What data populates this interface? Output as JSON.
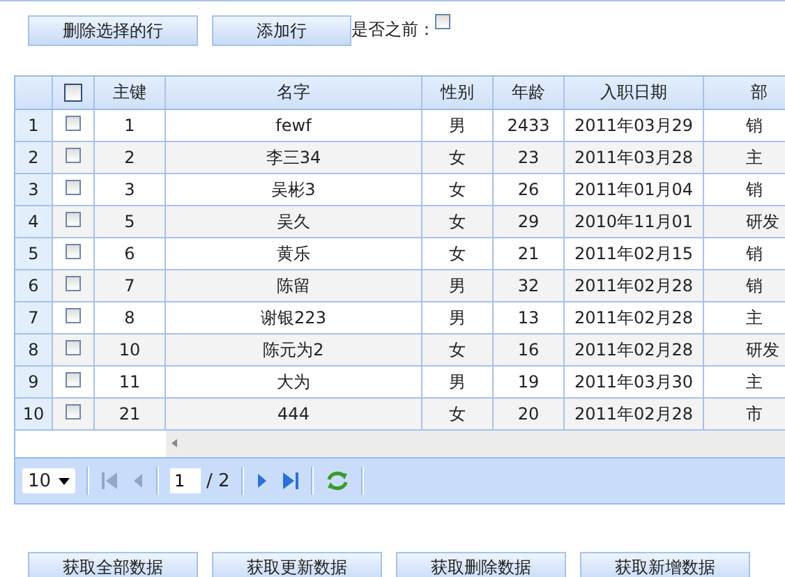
{
  "toolbar": {
    "buttons": [
      "删除选择的行",
      "添加行"
    ],
    "insert_before": {
      "label": "是否之前：",
      "checked": false
    }
  },
  "grid": {
    "columns": [
      "主键",
      "名字",
      "性别",
      "年龄",
      "入职日期",
      "部"
    ],
    "header_checked": false,
    "rows": [
      {
        "num": "1",
        "checked": false,
        "cells": [
          "1",
          "fewf",
          "男",
          "2433",
          "2011年03月29",
          "销"
        ]
      },
      {
        "num": "2",
        "checked": false,
        "cells": [
          "2",
          "李三34",
          "女",
          "23",
          "2011年03月28",
          "主"
        ]
      },
      {
        "num": "3",
        "checked": false,
        "cells": [
          "3",
          "吴彬3",
          "女",
          "26",
          "2011年01月04",
          "销"
        ]
      },
      {
        "num": "4",
        "checked": false,
        "cells": [
          "5",
          "吴久",
          "女",
          "29",
          "2010年11月01",
          "研发"
        ]
      },
      {
        "num": "5",
        "checked": false,
        "cells": [
          "6",
          "黄乐",
          "女",
          "21",
          "2011年02月15",
          "销"
        ]
      },
      {
        "num": "6",
        "checked": false,
        "cells": [
          "7",
          "陈留",
          "男",
          "32",
          "2011年02月28",
          "销"
        ]
      },
      {
        "num": "7",
        "checked": false,
        "cells": [
          "8",
          "谢银223",
          "男",
          "13",
          "2011年02月28",
          "主"
        ]
      },
      {
        "num": "8",
        "checked": false,
        "cells": [
          "10",
          "陈元为2",
          "女",
          "16",
          "2011年02月28",
          "研发"
        ]
      },
      {
        "num": "9",
        "checked": false,
        "cells": [
          "11",
          "大为",
          "男",
          "19",
          "2011年03月30",
          "主"
        ]
      },
      {
        "num": "10",
        "checked": false,
        "cells": [
          "21",
          "444",
          "女",
          "20",
          "2011年02月28",
          "市"
        ]
      }
    ]
  },
  "pager": {
    "page_size": "10",
    "page": "1",
    "total": "/ 2",
    "first_disabled": true,
    "last_disabled": false
  },
  "actions": [
    "获取全部数据",
    "获取更新数据",
    "获取删除数据",
    "获取新增数据"
  ]
}
